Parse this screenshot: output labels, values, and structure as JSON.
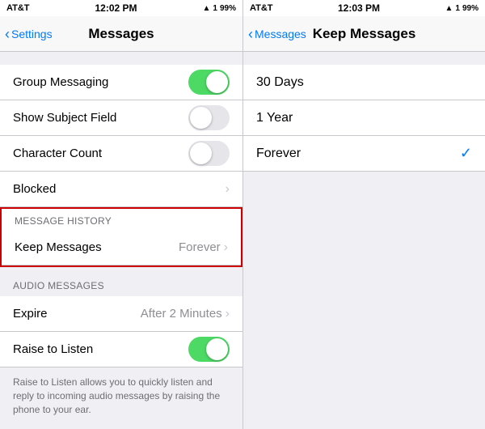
{
  "left": {
    "statusBar": {
      "carrier": "AT&T",
      "wifi": "wifi",
      "time": "12:02 PM",
      "gps": "▲",
      "signal": "1",
      "battery": "99%"
    },
    "navBar": {
      "backLabel": "Settings",
      "title": "Messages"
    },
    "cells": [
      {
        "id": "group-messaging",
        "label": "Group Messaging",
        "type": "toggle",
        "value": "on"
      },
      {
        "id": "show-subject-field",
        "label": "Show Subject Field",
        "type": "toggle",
        "value": "off"
      },
      {
        "id": "character-count",
        "label": "Character Count",
        "type": "toggle",
        "value": "off"
      },
      {
        "id": "blocked",
        "label": "Blocked",
        "type": "chevron",
        "value": ""
      }
    ],
    "messageHistorySection": {
      "header": "MESSAGE HISTORY",
      "cells": [
        {
          "id": "keep-messages",
          "label": "Keep Messages",
          "value": "Forever",
          "type": "chevron"
        }
      ]
    },
    "audioSection": {
      "header": "AUDIO MESSAGES",
      "cells": [
        {
          "id": "expire",
          "label": "Expire",
          "value": "After 2 Minutes",
          "type": "chevron"
        },
        {
          "id": "raise-to-listen",
          "label": "Raise to Listen",
          "type": "toggle",
          "value": "on"
        }
      ]
    },
    "description": "Raise to Listen allows you to quickly listen and reply to incoming audio messages by raising the phone to your ear."
  },
  "right": {
    "statusBar": {
      "carrier": "AT&T",
      "wifi": "wifi",
      "time": "12:03 PM",
      "gps": "▲",
      "signal": "1",
      "battery": "99%"
    },
    "navBar": {
      "backLabel": "Messages",
      "title": "Keep Messages"
    },
    "options": [
      {
        "id": "30-days",
        "label": "30 Days",
        "selected": false
      },
      {
        "id": "1-year",
        "label": "1 Year",
        "selected": false
      },
      {
        "id": "forever",
        "label": "Forever",
        "selected": true
      }
    ]
  }
}
